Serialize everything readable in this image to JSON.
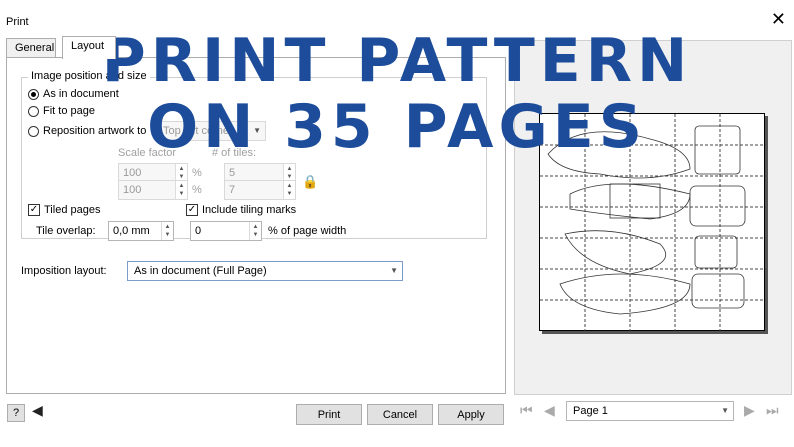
{
  "window": {
    "title": "Print"
  },
  "tabs": [
    {
      "label": "General"
    },
    {
      "label": "Layout"
    }
  ],
  "image_position": {
    "group_label": "Image position and size",
    "as_in_document": "As in document",
    "fit_to_page": "Fit to page",
    "reposition": "Reposition artwork to",
    "reposition_value": "Top left corner",
    "scale_factor": "Scale factor",
    "tiles_label": "# of tiles:",
    "scale_x": "100",
    "scale_y": "100",
    "tiles_x": "5",
    "tiles_y": "7",
    "percent": "%"
  },
  "tiling": {
    "tiled_pages": "Tiled pages",
    "include_marks": "Include tiling marks",
    "overlap_label": "Tile overlap:",
    "overlap_value": "0,0 mm",
    "overlap_percent": "0",
    "percent_of_width": "% of page width"
  },
  "imposition": {
    "label": "Imposition layout:",
    "value": "As in document (Full Page)"
  },
  "buttons": {
    "help": "?",
    "print": "Print",
    "cancel": "Cancel",
    "apply": "Apply"
  },
  "page_nav": {
    "value": "Page 1"
  },
  "overlay": {
    "line1": "PRINT PATTERN",
    "line2": "ON 35 PAGES"
  },
  "colors": {
    "overlay": "#1c4c9a"
  }
}
